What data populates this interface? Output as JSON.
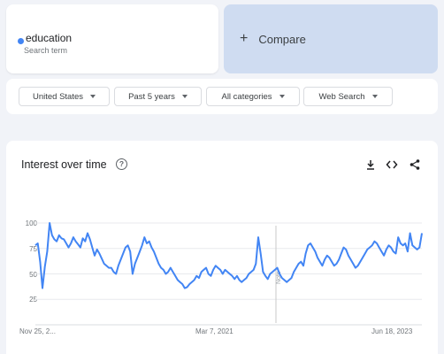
{
  "search_term": {
    "name": "education",
    "hint": "Search term",
    "color": "#4285f4"
  },
  "compare": {
    "plus": "+",
    "label": "Compare"
  },
  "filters": [
    {
      "label": "United States"
    },
    {
      "label": "Past 5 years"
    },
    {
      "label": "All categories"
    },
    {
      "label": "Web Search"
    }
  ],
  "chart_header": {
    "title": "Interest over time",
    "help_glyph": "?"
  },
  "tools": [
    "download-icon",
    "embed-icon",
    "share-icon"
  ],
  "note_marker": "Note",
  "chart_data": {
    "type": "line",
    "title": "Interest over time",
    "x_start_label": "Nov 25, 2...",
    "x_tick_labels": [
      "Nov 25, 2...",
      "Mar 7, 2021",
      "Jun 18, 2023"
    ],
    "y_tick_labels": [
      "100",
      "75",
      "50",
      "25"
    ],
    "ylim": [
      0,
      100
    ],
    "grid": true,
    "series": [
      {
        "color": "#4285f4",
        "values": [
          78,
          80,
          62,
          36,
          57,
          72,
          100,
          88,
          84,
          82,
          88,
          85,
          84,
          80,
          76,
          80,
          86,
          82,
          79,
          76,
          85,
          82,
          90,
          84,
          76,
          68,
          74,
          70,
          65,
          60,
          58,
          56,
          56,
          52,
          50,
          58,
          64,
          70,
          76,
          78,
          72,
          50,
          60,
          66,
          72,
          78,
          86,
          80,
          82,
          76,
          72,
          66,
          60,
          56,
          54,
          50,
          52,
          56,
          52,
          48,
          44,
          42,
          40,
          36,
          37,
          40,
          42,
          44,
          48,
          46,
          52,
          54,
          56,
          50,
          48,
          54,
          58,
          56,
          54,
          50,
          54,
          52,
          50,
          48,
          45,
          48,
          44,
          42,
          44,
          46,
          50,
          52,
          54,
          60,
          86,
          70,
          52,
          48,
          45,
          50,
          52,
          54,
          56,
          50,
          46,
          44,
          42,
          44,
          46,
          52,
          56,
          60,
          62,
          58,
          70,
          78,
          80,
          76,
          72,
          66,
          62,
          58,
          64,
          68,
          66,
          62,
          58,
          60,
          64,
          70,
          76,
          74,
          68,
          64,
          60,
          56,
          58,
          62,
          66,
          70,
          74,
          76,
          78,
          82,
          80,
          76,
          72,
          68,
          74,
          78,
          76,
          72,
          70,
          86,
          80,
          78,
          80,
          72,
          90,
          78,
          76,
          74,
          76,
          90
        ]
      }
    ]
  }
}
